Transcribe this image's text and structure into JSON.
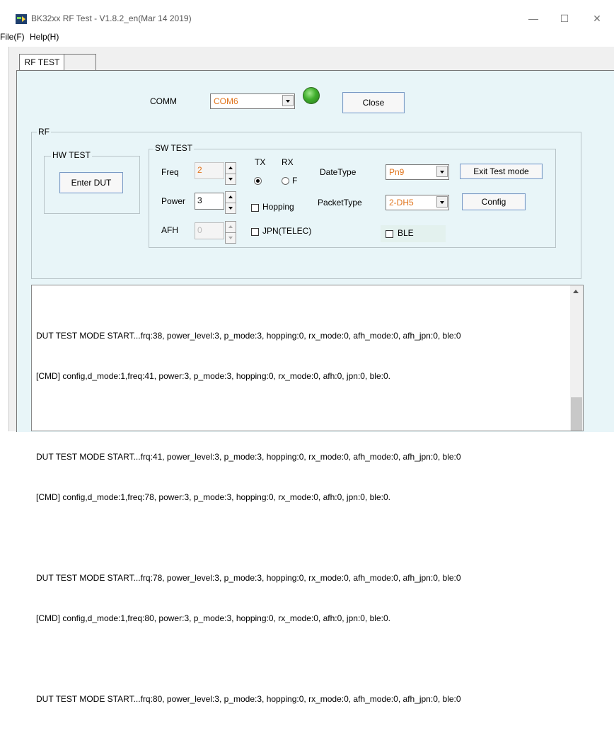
{
  "window": {
    "title": "BK32xx RF Test - V1.8.2_en(Mar 14 2019)",
    "buttons": {
      "minimize": "—",
      "maximize": "☐",
      "close": "✕"
    }
  },
  "menu": [
    {
      "label": "File(F)",
      "accel": "F"
    },
    {
      "label": "Help(H)",
      "accel": "H"
    }
  ],
  "tabs": [
    {
      "label": "RF TEST",
      "selected": true
    },
    {
      "label": "",
      "selected": false
    }
  ],
  "comm": {
    "label": "COMM",
    "port_value": "COM6",
    "status_led_color": "#3fae2c",
    "close_button": "Close"
  },
  "rf": {
    "group_label": "RF",
    "hw_test": {
      "group_label": "HW TEST",
      "enter_dut_button": "Enter DUT"
    },
    "sw_test": {
      "group_label": "SW TEST",
      "freq": {
        "label": "Freq",
        "value": "2",
        "disabled": true
      },
      "power": {
        "label": "Power",
        "value": "3"
      },
      "afh": {
        "label": "AFH",
        "value": "0",
        "disabled": true
      },
      "tx": {
        "label": "TX",
        "checked": true
      },
      "rx": {
        "label": "RX",
        "radio_text": "F",
        "checked": false
      },
      "hopping": {
        "label": "Hopping",
        "checked": false
      },
      "jpn": {
        "label": "JPN(TELEC)",
        "checked": false
      },
      "date_type": {
        "label": "DateType",
        "value": "Pn9"
      },
      "packet_type": {
        "label": "PacketType",
        "value": "2-DH5"
      },
      "ble": {
        "label": "BLE",
        "checked": false
      },
      "exit_test_button": "Exit Test mode",
      "config_button": "Config"
    }
  },
  "log": {
    "lines": [
      "DUT TEST MODE START...frq:38, power_level:3, p_mode:3, hopping:0, rx_mode:0, afh_mode:0, afh_jpn:0, ble:0",
      "[CMD] config,d_mode:1,freq:41, power:3, p_mode:3, hopping:0, rx_mode:0, afh:0, jpn:0, ble:0.",
      "",
      "DUT TEST MODE START...frq:41, power_level:3, p_mode:3, hopping:0, rx_mode:0, afh_mode:0, afh_jpn:0, ble:0",
      "[CMD] config,d_mode:1,freq:78, power:3, p_mode:3, hopping:0, rx_mode:0, afh:0, jpn:0, ble:0.",
      "",
      "DUT TEST MODE START...frq:78, power_level:3, p_mode:3, hopping:0, rx_mode:0, afh_mode:0, afh_jpn:0, ble:0",
      "[CMD] config,d_mode:1,freq:80, power:3, p_mode:3, hopping:0, rx_mode:0, afh:0, jpn:0, ble:0.",
      "",
      "DUT TEST MODE START...frq:80, power_level:3, p_mode:3, hopping:0, rx_mode:0, afh_mode:0, afh_jpn:0, ble:0"
    ]
  }
}
